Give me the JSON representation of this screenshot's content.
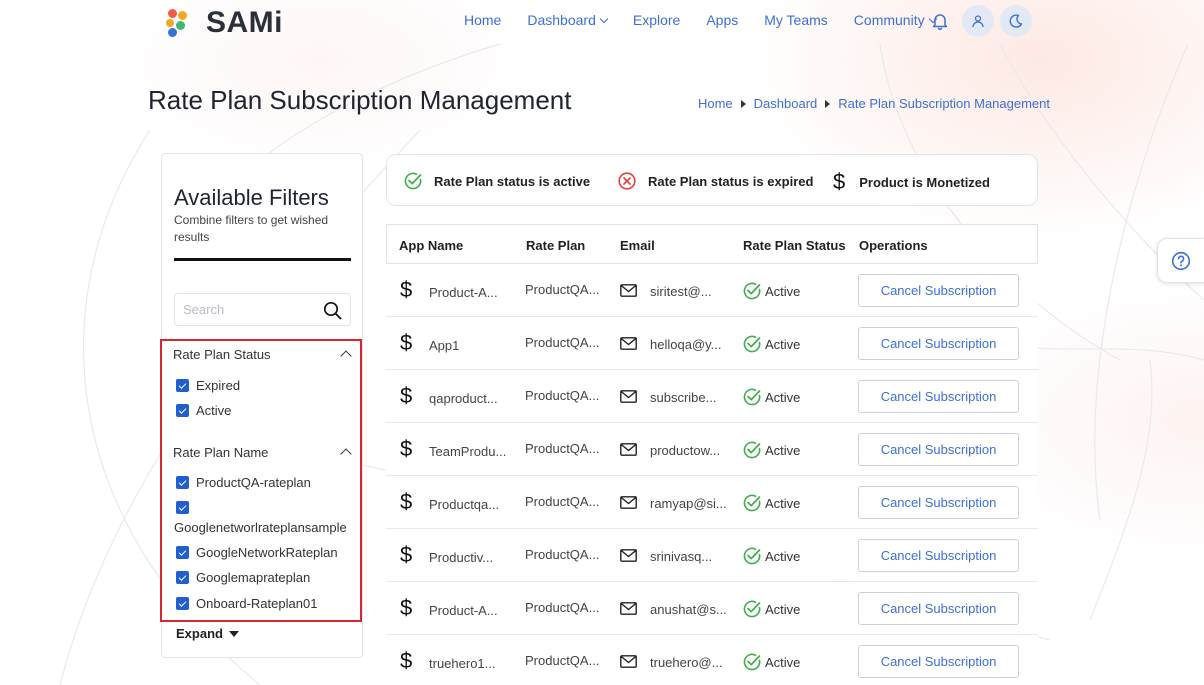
{
  "app": {
    "logo_text": "SAMi",
    "brand_color": "#3d6fd8"
  },
  "nav": {
    "items": [
      {
        "label": "Home",
        "has_caret": false
      },
      {
        "label": "Dashboard",
        "has_caret": true
      },
      {
        "label": "Explore",
        "has_caret": false
      },
      {
        "label": "Apps",
        "has_caret": false
      },
      {
        "label": "My Teams",
        "has_caret": false
      },
      {
        "label": "Community",
        "has_caret": true
      }
    ],
    "icons": [
      "bell-icon",
      "user-icon",
      "moon-icon"
    ]
  },
  "page": {
    "title": "Rate Plan Subscription Management",
    "breadcrumb": [
      "Home",
      "Dashboard",
      "Rate Plan Subscription Management"
    ]
  },
  "filters": {
    "title": "Available Filters",
    "subtitle": "Combine filters to get wished results",
    "search_placeholder": "Search",
    "status_group": {
      "label": "Rate Plan Status",
      "options": [
        {
          "label": "Expired",
          "checked": true
        },
        {
          "label": "Active",
          "checked": true
        }
      ]
    },
    "name_group": {
      "label": "Rate Plan Name",
      "options": [
        {
          "label": "ProductQA-rateplan",
          "checked": true
        },
        {
          "label": "Googlenetworlrateplansample",
          "checked": true
        },
        {
          "label": "GoogleNetworkRateplan",
          "checked": true
        },
        {
          "label": "Googlemaprateplan",
          "checked": true
        },
        {
          "label": "Onboard-Rateplan01",
          "checked": true
        }
      ]
    },
    "expand_label": "Expand"
  },
  "legend": {
    "active": "Rate Plan status is active",
    "expired": "Rate Plan status is expired",
    "monetized": "Product is Monetized",
    "active_color": "#3fae49",
    "expired_color": "#e0413a"
  },
  "table": {
    "headers": {
      "app_name": "App Name",
      "rate_plan": "Rate Plan",
      "email": "Email",
      "status": "Rate Plan Status",
      "operations": "Operations"
    },
    "rows": [
      {
        "app": "Product-A...",
        "rate_plan": "ProductQA...",
        "email": "siritest@...",
        "status": "Active",
        "action": "Cancel Subscription"
      },
      {
        "app": "App1",
        "rate_plan": "ProductQA...",
        "email": "helloqa@y...",
        "status": "Active",
        "action": "Cancel Subscription"
      },
      {
        "app": "qaproduct...",
        "rate_plan": "ProductQA...",
        "email": "subscribe...",
        "status": "Active",
        "action": "Cancel Subscription"
      },
      {
        "app": "TeamProdu...",
        "rate_plan": "ProductQA...",
        "email": "productow...",
        "status": "Active",
        "action": "Cancel Subscription"
      },
      {
        "app": "Productqa...",
        "rate_plan": "ProductQA...",
        "email": "ramyap@si...",
        "status": "Active",
        "action": "Cancel Subscription"
      },
      {
        "app": "Productiv...",
        "rate_plan": "ProductQA...",
        "email": "srinivasq...",
        "status": "Active",
        "action": "Cancel Subscription"
      },
      {
        "app": "Product-A...",
        "rate_plan": "ProductQA...",
        "email": "anushat@s...",
        "status": "Active",
        "action": "Cancel Subscription"
      },
      {
        "app": "truehero1...",
        "rate_plan": "ProductQA...",
        "email": "truehero@...",
        "status": "Active",
        "action": "Cancel Subscription"
      }
    ]
  }
}
